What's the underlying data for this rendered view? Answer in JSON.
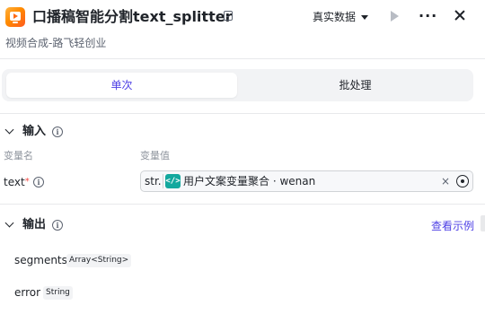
{
  "header": {
    "title": "口播稿智能分割text_splitter",
    "subtitle": "视频合成-路飞轻创业",
    "data_source_label": "真实数据",
    "more_label": "···",
    "icon": "video-play-icon"
  },
  "tabs": [
    {
      "label": "单次",
      "active": true
    },
    {
      "label": "批处理",
      "active": false
    }
  ],
  "input_section": {
    "title": "输入",
    "col_name": "变量名",
    "col_value": "变量值",
    "variables": [
      {
        "name": "text",
        "required_mark": "*",
        "type_prefix": "str.",
        "ref_icon_label": "</>",
        "reference": "用户文案变量聚合 · wenan",
        "clear_label": "×"
      }
    ]
  },
  "output_section": {
    "title": "输出",
    "example_link": "查看示例",
    "fields": [
      {
        "name": "segments",
        "type": "Array<String>"
      },
      {
        "name": "error",
        "type": "String"
      }
    ]
  },
  "colors": {
    "accent": "#4e40e5",
    "variable_icon": "#13a89e",
    "required": "#f54a45"
  }
}
